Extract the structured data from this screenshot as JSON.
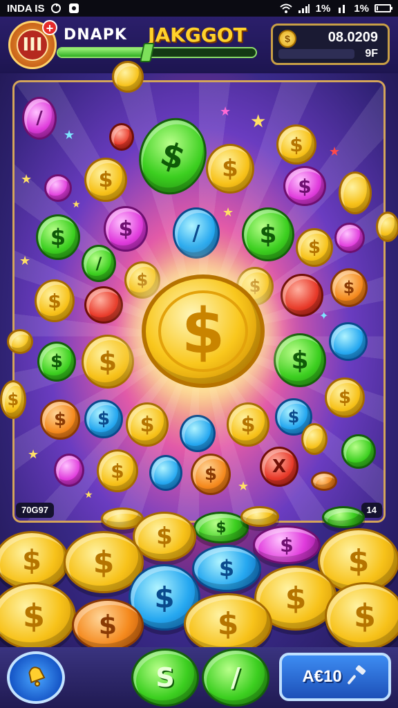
{
  "status_bar": {
    "carrier": "INDA IS",
    "battery_text": "1%",
    "secondary_percent": "1%",
    "battery_level": 0.1
  },
  "hud": {
    "level_badge_text": "III",
    "level_badge_plus": "+",
    "player_name": "DNAPK",
    "jackpot_label": "JAKGGOT",
    "jackpot_progress": 0.45,
    "score_value": "08.0209",
    "score_sub_value": "9F",
    "score_coin_symbol": "$"
  },
  "playfield": {
    "left_corner_label": "70G97",
    "right_corner_label": "14",
    "big_coin_symbol": "$",
    "coin_symbol": "$"
  },
  "bottom_bar": {
    "bell_icon": "bell-icon",
    "coin_button_1_symbol": "S",
    "coin_button_2_symbol": "/",
    "action_button_label": "A€10",
    "action_icon": "hammer-icon"
  },
  "colors": {
    "gold": "#f7c21a",
    "green": "#3ccf20",
    "blue": "#26a8f0",
    "pink": "#e03cdc",
    "red": "#e83a2a",
    "orange": "#f58a1e",
    "frame": "#d4a55a"
  }
}
